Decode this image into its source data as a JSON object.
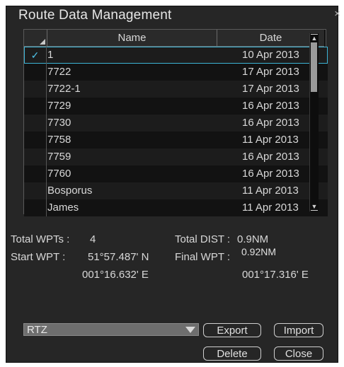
{
  "dialog": {
    "title": "Route Data Management",
    "close_glyph": "×"
  },
  "table": {
    "headers": {
      "name": "Name",
      "date": "Date"
    },
    "rows": [
      {
        "checked": true,
        "check_glyph": "✓",
        "name": "1",
        "date": "10 Apr 2013"
      },
      {
        "checked": false,
        "check_glyph": "",
        "name": "7722",
        "date": "17 Apr 2013"
      },
      {
        "checked": false,
        "check_glyph": "",
        "name": "7722-1",
        "date": "17 Apr 2013"
      },
      {
        "checked": false,
        "check_glyph": "",
        "name": "7729",
        "date": "16 Apr 2013"
      },
      {
        "checked": false,
        "check_glyph": "",
        "name": "7730",
        "date": "16 Apr 2013"
      },
      {
        "checked": false,
        "check_glyph": "",
        "name": "7758",
        "date": "11 Apr 2013"
      },
      {
        "checked": false,
        "check_glyph": "",
        "name": "7759",
        "date": "16 Apr 2013"
      },
      {
        "checked": false,
        "check_glyph": "",
        "name": "7760",
        "date": "16 Apr 2013"
      },
      {
        "checked": false,
        "check_glyph": "",
        "name": "Bosporus",
        "date": "11 Apr 2013"
      },
      {
        "checked": false,
        "check_glyph": "",
        "name": "James",
        "date": "11 Apr 2013"
      }
    ]
  },
  "summary": {
    "total_wpts_label": "Total WPTs :",
    "total_wpts_value": "4",
    "total_dist_label": "Total DIST :",
    "total_dist_value": "0.9NM",
    "total_dist_overlay": "0.92NM",
    "start_wpt_label": "Start WPT :",
    "start_lat": "51°57.487' N",
    "start_lon": "001°16.632' E",
    "final_wpt_label": "Final WPT :",
    "final_lon": "001°17.316' E"
  },
  "controls": {
    "format_selected": "RTZ",
    "export_label": "Export",
    "import_label": "Import",
    "delete_label": "Delete",
    "close_label": "Close"
  },
  "colors": {
    "accent_check": "#4fc3e8",
    "selected_outline": "#3cb4d6",
    "dialog_bg": "#262626"
  }
}
